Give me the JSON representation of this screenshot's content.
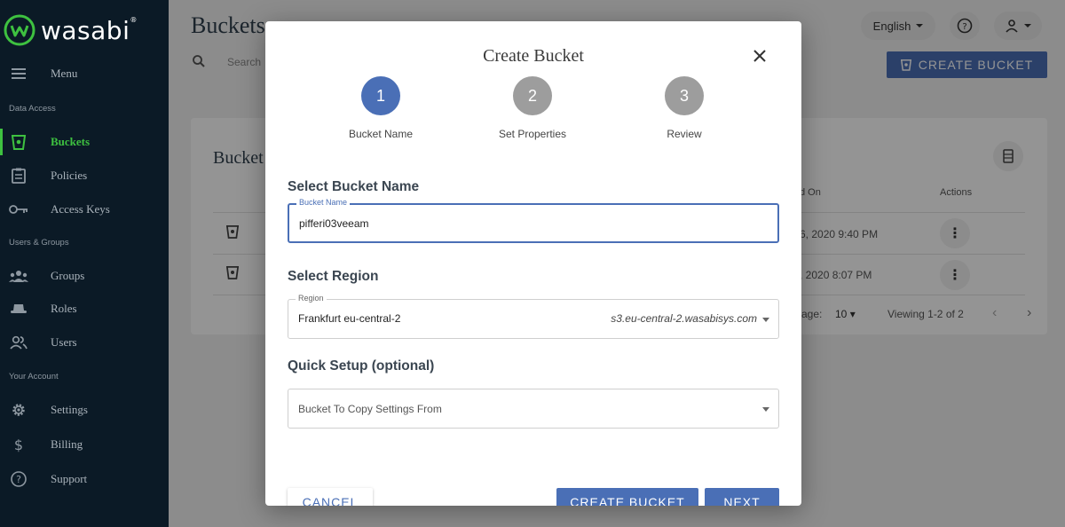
{
  "brand": {
    "name": "wasabi",
    "mark": "®"
  },
  "sidebar": {
    "menu_label": "Menu",
    "sections": {
      "data_access": "Data Access",
      "users_groups": "Users & Groups",
      "your_account": "Your Account"
    },
    "items": [
      {
        "label": "Buckets",
        "icon": "bucket-icon",
        "active": true
      },
      {
        "label": "Policies",
        "icon": "clipboard-icon",
        "active": false
      },
      {
        "label": "Access Keys",
        "icon": "key-icon",
        "active": false
      },
      {
        "label": "Groups",
        "icon": "group-icon",
        "active": false
      },
      {
        "label": "Roles",
        "icon": "hat-icon",
        "active": false
      },
      {
        "label": "Users",
        "icon": "users-icon",
        "active": false
      },
      {
        "label": "Settings",
        "icon": "gear-icon",
        "active": false
      },
      {
        "label": "Billing",
        "icon": "dollar-icon",
        "active": false
      },
      {
        "label": "Support",
        "icon": "help-circle-icon",
        "active": false
      }
    ]
  },
  "header": {
    "title": "Buckets",
    "search_placeholder": "Search",
    "language": "English",
    "create_button": "CREATE BUCKET"
  },
  "table": {
    "title": "Bucket",
    "col_created": "d On",
    "col_actions": "Actions",
    "rows": [
      {
        "date": "6, 2020 9:40 PM"
      },
      {
        "date": ", 2020 8:07 PM"
      }
    ],
    "pager": {
      "per_page_label": "age:",
      "per_page_value": "10",
      "viewing": "Viewing 1-2 of 2"
    }
  },
  "modal": {
    "title": "Create Bucket",
    "steps": [
      {
        "number": "1",
        "label": "Bucket Name",
        "active": true
      },
      {
        "number": "2",
        "label": "Set Properties",
        "active": false
      },
      {
        "number": "3",
        "label": "Review",
        "active": false
      }
    ],
    "bucket_name_section": "Select Bucket Name",
    "bucket_name_field": {
      "label": "Bucket Name",
      "value": "pifferi03veeam"
    },
    "region_section": "Select Region",
    "region_field": {
      "label": "Region",
      "value": "Frankfurt eu-central-2",
      "endpoint": "s3.eu-central-2.wasabisys.com"
    },
    "quick_setup_section": "Quick Setup (optional)",
    "copy_settings_field": {
      "placeholder": "Bucket To Copy Settings From"
    },
    "buttons": {
      "cancel": "CANCEL",
      "create": "CREATE BUCKET",
      "next": "NEXT"
    }
  },
  "colors": {
    "sidebar_bg": "#0b1a26",
    "accent_green": "#3ec140",
    "primary_blue": "#4a6fb6",
    "step_inactive": "#9d9d9d"
  }
}
